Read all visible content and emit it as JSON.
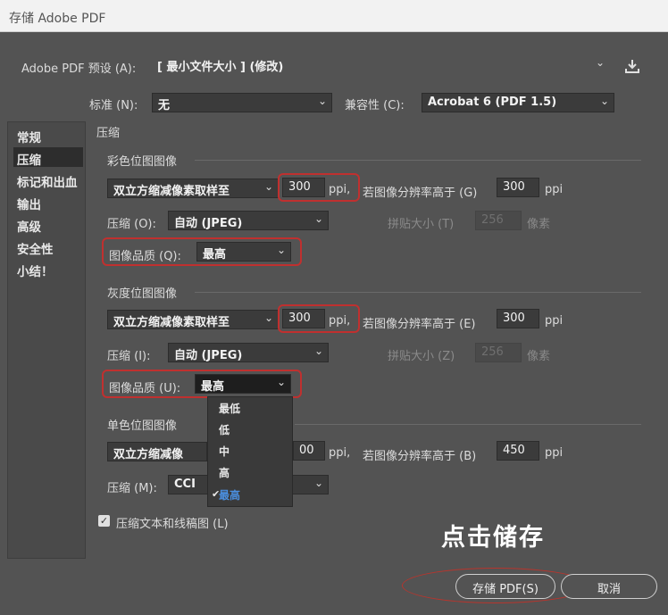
{
  "window": {
    "title": "存储 Adobe PDF"
  },
  "preset": {
    "label": "Adobe PDF 预设 (A):",
    "value": "[ 最小文件大小 ] (修改)"
  },
  "standard": {
    "label": "标准 (N):",
    "value": "无"
  },
  "compatibility": {
    "label": "兼容性 (C):",
    "value": "Acrobat 6 (PDF 1.5)"
  },
  "sidebar": {
    "items": [
      {
        "label": "常规"
      },
      {
        "label": "压缩"
      },
      {
        "label": "标记和出血"
      },
      {
        "label": "输出"
      },
      {
        "label": "高级"
      },
      {
        "label": "安全性"
      },
      {
        "label": "小结！"
      }
    ]
  },
  "section_title": "压缩",
  "color_bitmap": {
    "title": "彩色位图图像",
    "sampling": "双立方缩减像素取样至",
    "ppi_value": "300",
    "ppi_unit": "ppi,",
    "threshold_label": "若图像分辨率高于 (G)",
    "threshold_value": "300",
    "threshold_unit": "ppi",
    "compression_label": "压缩 (O):",
    "compression_value": "自动 (JPEG)",
    "tile_label": "拼贴大小 (T)",
    "tile_value": "256",
    "tile_unit": "像素",
    "quality_label": "图像品质 (Q):",
    "quality_value": "最高"
  },
  "gray_bitmap": {
    "title": "灰度位图图像",
    "sampling": "双立方缩减像素取样至",
    "ppi_value": "300",
    "ppi_unit": "ppi,",
    "threshold_label": "若图像分辨率高于 (E)",
    "threshold_value": "300",
    "threshold_unit": "ppi",
    "compression_label": "压缩 (I):",
    "compression_value": "自动 (JPEG)",
    "tile_label": "拼贴大小 (Z)",
    "tile_value": "256",
    "tile_unit": "像素",
    "quality_label": "图像品质 (U):",
    "quality_value": "最高"
  },
  "mono_bitmap": {
    "title": "单色位图图像",
    "sampling": "双立方缩减像",
    "ppi_value": "00",
    "ppi_unit": "ppi,",
    "threshold_label": "若图像分辨率高于 (B)",
    "threshold_value": "450",
    "threshold_unit": "ppi",
    "compression_label": "压缩 (M):",
    "compression_value": "CCI"
  },
  "quality_menu": {
    "options": [
      "最低",
      "低",
      "中",
      "高",
      "最高"
    ],
    "selected": "最高"
  },
  "compress_text": {
    "label": "压缩文本和线稿图 (L)",
    "checked": true
  },
  "overlay_annotation": "点击储存",
  "buttons": {
    "save": "存储 PDF(S)",
    "cancel": "取消"
  }
}
